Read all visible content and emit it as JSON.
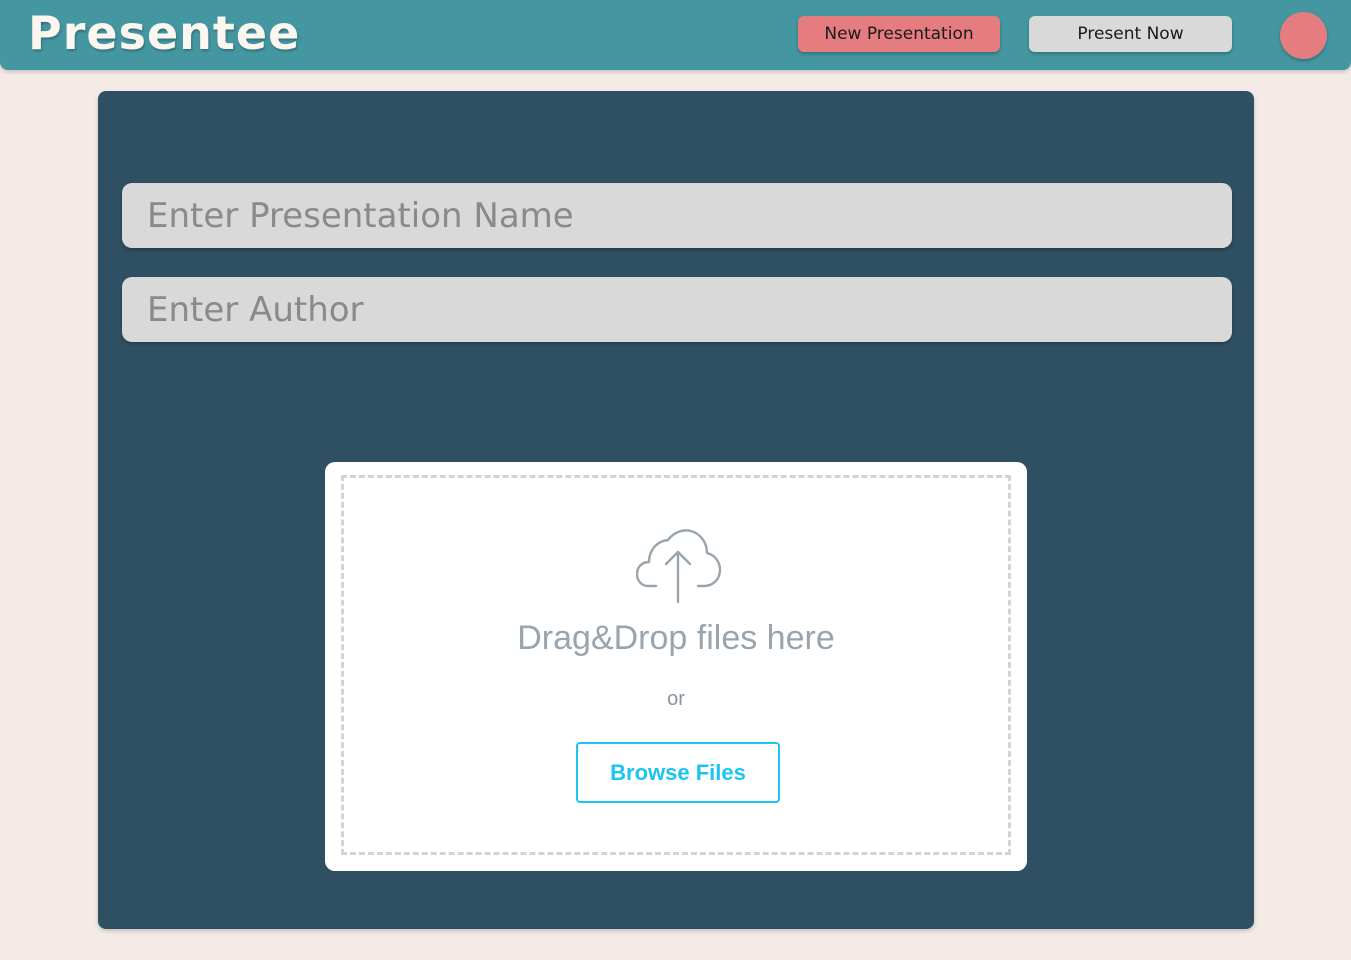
{
  "header": {
    "app_name": "Presentee",
    "new_presentation_label": "New Presentation",
    "present_now_label": "Present Now",
    "avatar_icon": "user-avatar-icon"
  },
  "form": {
    "presentation_name_placeholder": "Enter Presentation Name",
    "presentation_name_value": "",
    "author_placeholder": "Enter Author",
    "author_value": ""
  },
  "upload": {
    "icon": "cloud-upload-icon",
    "drop_text": "Drag&Drop files here",
    "or_text": "or",
    "browse_label": "Browse Files"
  },
  "colors": {
    "header_bg": "#4497a1",
    "panel_bg": "#2f5062",
    "accent_pink": "#e57d80",
    "browse_blue": "#1cc4f1",
    "page_bg": "#f4ebe6"
  }
}
